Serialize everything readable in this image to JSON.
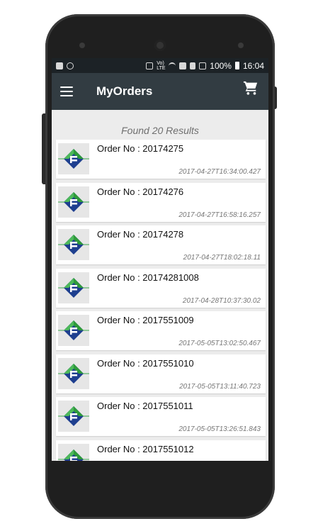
{
  "status_bar": {
    "battery_text": "100%",
    "time": "16:04",
    "network_text": "Vo) LTE"
  },
  "app_bar": {
    "title": "MyOrders",
    "menu_icon": "hamburger-menu-icon",
    "cart_icon": "cart-icon"
  },
  "results_text": "Found 20 Results",
  "orders": [
    {
      "label": "Order No : 20174275",
      "date": "2017-04-27T16:34:00.427"
    },
    {
      "label": "Order No : 20174276",
      "date": "2017-04-27T16:58:16.257"
    },
    {
      "label": "Order No : 20174278",
      "date": "2017-04-27T18:02:18.11"
    },
    {
      "label": "Order No : 20174281008",
      "date": "2017-04-28T10:37:30.02"
    },
    {
      "label": "Order No : 2017551009",
      "date": "2017-05-05T13:02:50.467"
    },
    {
      "label": "Order No : 2017551010",
      "date": "2017-05-05T13:11:40.723"
    },
    {
      "label": "Order No : 2017551011",
      "date": "2017-05-05T13:26:51.843"
    },
    {
      "label": "Order No : 2017551012",
      "date": ""
    }
  ],
  "colors": {
    "app_bar": "#323c42",
    "status_bar": "#1c2226",
    "background": "#ececec",
    "logo_green": "#2e9a3a",
    "logo_blue": "#1e3f8f"
  }
}
